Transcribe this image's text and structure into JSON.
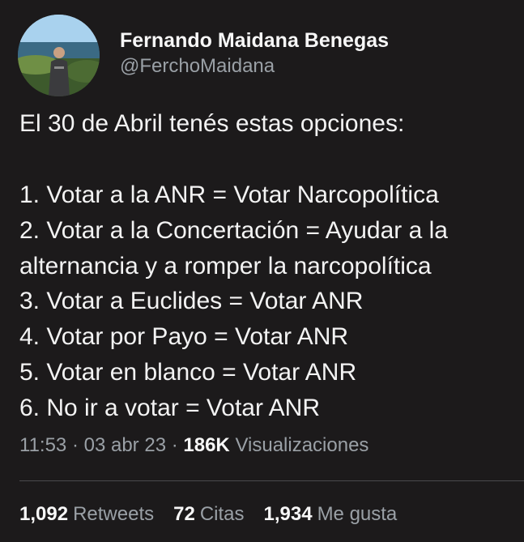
{
  "author": {
    "display_name": "Fernando Maidana Benegas",
    "handle": "@FerchoMaidana"
  },
  "tweet": {
    "lines": [
      "El 30 de Abril tenés estas opciones:",
      "",
      "1. Votar a la ANR = Votar Narcopolítica",
      "2. Votar a la Concertación = Ayudar a la",
      "alternancia y a romper la narcopolítica",
      "3. Votar a Euclides = Votar ANR",
      "4. Votar por Payo = Votar ANR",
      "5. Votar en blanco = Votar ANR",
      "6. No ir a votar = Votar ANR"
    ]
  },
  "meta": {
    "time": "11:53",
    "date": "03 abr 23",
    "separator": "·",
    "views_count": "186K",
    "views_label": "Visualizaciones"
  },
  "stats": {
    "retweets_count": "1,092",
    "retweets_label": "Retweets",
    "quotes_count": "72",
    "quotes_label": "Citas",
    "likes_count": "1,934",
    "likes_label": "Me gusta"
  },
  "colors": {
    "background": "#1c1a1b",
    "primary_text": "#f3f3f3",
    "secondary_text": "#9aa0a6",
    "divider": "#4a4a4d"
  }
}
